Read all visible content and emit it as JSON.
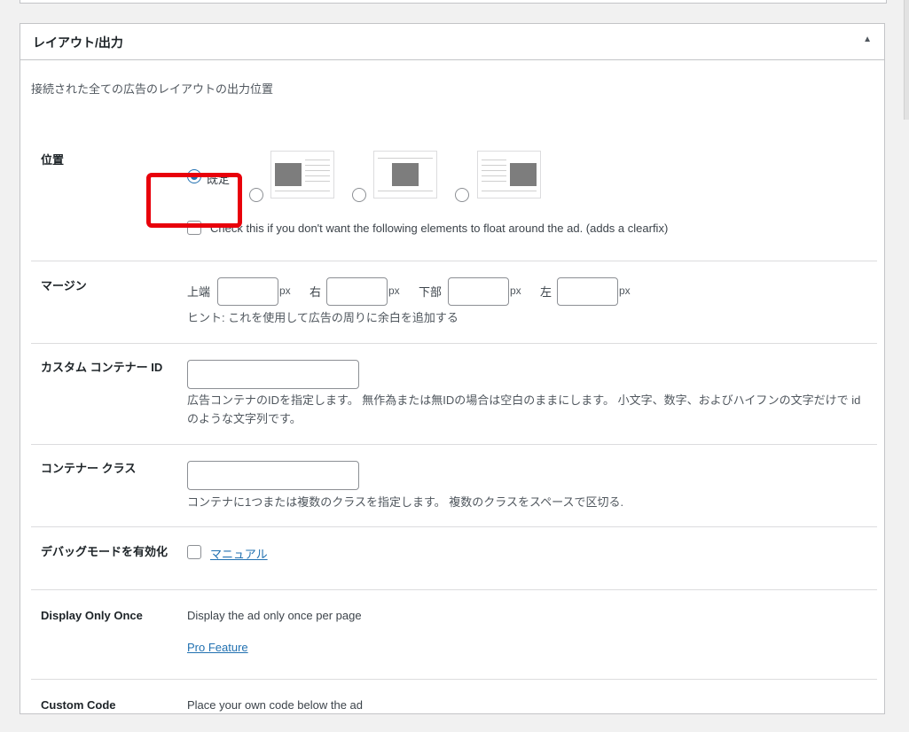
{
  "panel": {
    "title": "レイアウト/出力",
    "toggle_symbol": "▲",
    "description": "接続された全ての広告のレイアウトの出力位置"
  },
  "position": {
    "label": "位置",
    "default_option": "既定",
    "options": [
      "default",
      "left",
      "center",
      "right"
    ],
    "selected": "default",
    "clearfix_label": "Check this if you don't want the following elements to float around the ad. (adds a clearfix)",
    "clearfix_checked": false
  },
  "margin": {
    "label": "マージン",
    "top_label": "上端",
    "right_label": "右",
    "bottom_label": "下部",
    "left_label": "左",
    "unit": "px",
    "top_value": "",
    "right_value": "",
    "bottom_value": "",
    "left_value": "",
    "hint": "ヒント: これを使用して広告の周りに余白を追加する"
  },
  "container_id": {
    "label": "カスタム コンテナー ID",
    "value": "",
    "hint": "広告コンテナのIDを指定します。 無作為または無IDの場合は空白のままにします。 小文字、数字、およびハイフンの文字だけで id のような文字列です。"
  },
  "container_class": {
    "label": "コンテナー クラス",
    "value": "",
    "hint": "コンテナに1つまたは複数のクラスを指定します。 複数のクラスをスペースで区切る."
  },
  "debug": {
    "label": "デバッグモードを有効化",
    "link": "マニュアル",
    "checked": false
  },
  "display_once": {
    "label": "Display Only Once",
    "description": "Display the ad only once per page",
    "link": "Pro Feature"
  },
  "custom_code": {
    "label": "Custom Code",
    "description": "Place your own code below the ad"
  },
  "colors": {
    "accent": "#2271b1",
    "highlight": "#e8000b",
    "border": "#c3c4c7"
  }
}
